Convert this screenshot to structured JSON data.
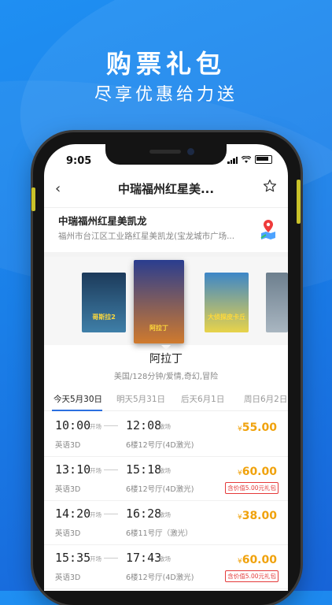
{
  "promo": {
    "title": "购票礼包",
    "subtitle": "尽享优惠给力送"
  },
  "status_bar": {
    "time": "9:05"
  },
  "header": {
    "title": "中瑞福州红星美..."
  },
  "cinema": {
    "name": "中瑞福州红星美凯龙",
    "address": "福州市台江区工业路红星美凯龙(宝龙城市广场..."
  },
  "posters": [
    {
      "text": "哥斯拉2",
      "colors": [
        "#1c3a5a",
        "#3f7fa8"
      ]
    },
    {
      "text": "阿拉丁",
      "colors": [
        "#2a3d8f",
        "#d07a2d"
      ]
    },
    {
      "text": "大侦探皮卡丘",
      "colors": [
        "#3d86c8",
        "#e8d34a"
      ]
    },
    {
      "text": "",
      "colors": [
        "#6d7f8e",
        "#a9b6c1"
      ]
    }
  ],
  "movie": {
    "title": "阿拉丁",
    "meta": "美国/128分钟/爱情,奇幻,冒险"
  },
  "date_tabs": [
    "今天5月30日",
    "明天5月31日",
    "后天6月1日",
    "周日6月2日"
  ],
  "sessions": [
    {
      "start": "10:00",
      "start_tag": "开场",
      "end": "12:08",
      "end_tag": "散场",
      "lang": "英语3D",
      "hall": "6楼12号厅(4D激光)",
      "price": "55.00",
      "badge": ""
    },
    {
      "start": "13:10",
      "start_tag": "开场",
      "end": "15:18",
      "end_tag": "散场",
      "lang": "英语3D",
      "hall": "6楼12号厅(4D激光)",
      "price": "60.00",
      "badge": "含价值5.00元礼包"
    },
    {
      "start": "14:20",
      "start_tag": "开场",
      "end": "16:28",
      "end_tag": "散场",
      "lang": "英语3D",
      "hall": "6楼11号厅（激光）",
      "price": "38.00",
      "badge": ""
    },
    {
      "start": "15:35",
      "start_tag": "开场",
      "end": "17:43",
      "end_tag": "散场",
      "lang": "英语3D",
      "hall": "6楼12号厅(4D激光)",
      "price": "60.00",
      "badge": "含价值5.00元礼包"
    }
  ],
  "currency": "¥",
  "colors": {
    "accent": "#2b6fe0",
    "price": "#f0a20c",
    "badge": "#e43a3a",
    "background": "#1a7fe8"
  }
}
